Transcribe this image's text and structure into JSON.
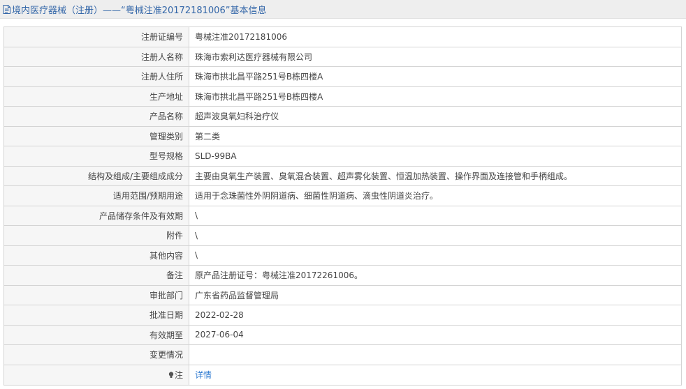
{
  "header": {
    "title": "境内医疗器械（注册）——“粤械注准20172181006”基本信息",
    "icon": "document-icon"
  },
  "rows": [
    {
      "label": "注册证编号",
      "value": "粤械注准20172181006"
    },
    {
      "label": "注册人名称",
      "value": "珠海市索利达医疗器械有限公司"
    },
    {
      "label": "注册人住所",
      "value": "珠海市拱北昌平路251号B栋四楼A"
    },
    {
      "label": "生产地址",
      "value": "珠海市拱北昌平路251号B栋四楼A"
    },
    {
      "label": "产品名称",
      "value": "超声波臭氧妇科治疗仪"
    },
    {
      "label": "管理类别",
      "value": "第二类"
    },
    {
      "label": "型号规格",
      "value": "SLD-99BA"
    },
    {
      "label": "结构及组成/主要组成成分",
      "value": "主要由臭氧生产装置、臭氧混合装置、超声雾化装置、恒温加热装置、操作界面及连接管和手柄组成。"
    },
    {
      "label": "适用范围/预期用途",
      "value": "适用于念珠菌性外阴阴道病、细菌性阴道病、滴虫性阴道炎治疗。"
    },
    {
      "label": "产品储存条件及有效期",
      "value": "\\"
    },
    {
      "label": "附件",
      "value": "\\"
    },
    {
      "label": "其他内容",
      "value": "\\"
    },
    {
      "label": "备注",
      "value": "原产品注册证号：粤械注准20172261006。"
    },
    {
      "label": "审批部门",
      "value": "广东省药品监督管理局"
    },
    {
      "label": "批准日期",
      "value": "2022-02-28"
    },
    {
      "label": "有效期至",
      "value": "2027-06-04"
    },
    {
      "label": "变更情况",
      "value": ""
    }
  ],
  "note_row": {
    "label": "注",
    "icon": "lightbulb-icon",
    "link_text": "详情"
  },
  "colors": {
    "title": "#3366a8",
    "link": "#2f7bd1",
    "label_bg": "#f6f6f6",
    "border": "#d4d4d4"
  }
}
